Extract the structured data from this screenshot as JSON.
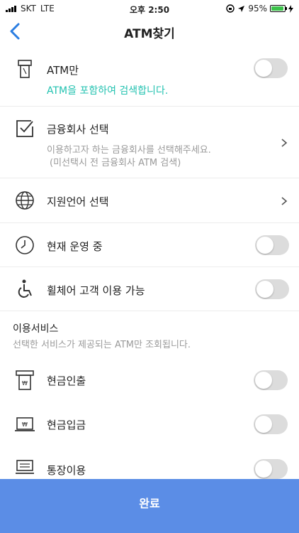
{
  "status": {
    "carrier": "SKT",
    "network": "LTE",
    "time": "오후 2:50",
    "battery": "95%",
    "battery_level": 0.95
  },
  "nav": {
    "title": "ATM찾기"
  },
  "atm_only": {
    "label": "ATM만",
    "sub": "ATM을 포함하여 검색합니다."
  },
  "finance": {
    "label": "금융회사 선택",
    "sub1": "이용하고자 하는 금융회사를 선택해주세요.",
    "sub2": "(미선택시 전 금융회사 ATM 검색)"
  },
  "language": {
    "label": "지원언어 선택"
  },
  "operating": {
    "label": "현재 운영 중"
  },
  "wheelchair": {
    "label": "휠체어 고객 이용 가능"
  },
  "services": {
    "title": "이용서비스",
    "sub": "선택한 서비스가 제공되는 ATM만 조회됩니다."
  },
  "withdraw": {
    "label": "현금인출"
  },
  "deposit": {
    "label": "현금입금"
  },
  "passbook": {
    "label": "통장이용"
  },
  "done": {
    "label": "완료"
  },
  "colors": {
    "accent": "#2a7de1",
    "teal": "#22c2b0",
    "button": "#5b8de6"
  }
}
